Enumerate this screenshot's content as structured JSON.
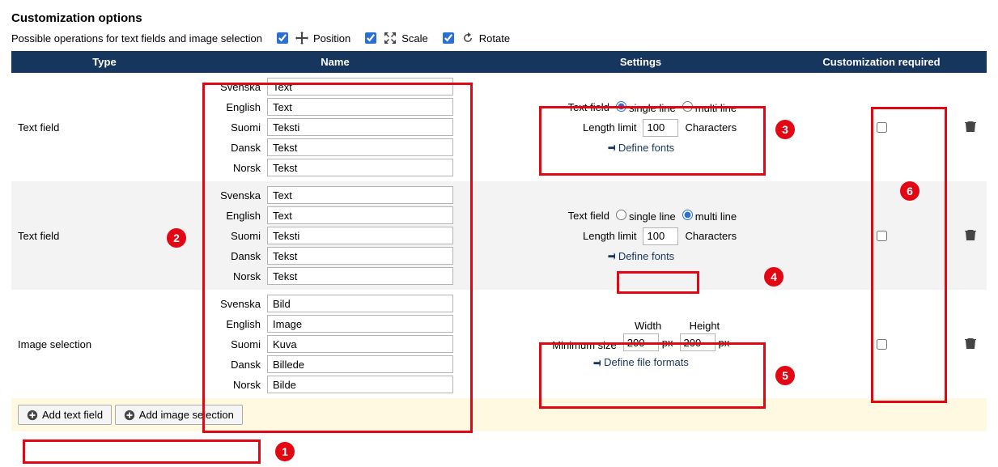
{
  "title": "Customization options",
  "ops_label": "Possible operations for text fields and image selection",
  "ops": {
    "position": "Position",
    "scale": "Scale",
    "rotate": "Rotate"
  },
  "headers": {
    "type": "Type",
    "name": "Name",
    "settings": "Settings",
    "required": "Customization required"
  },
  "langs": {
    "sv": "Svenska",
    "en": "English",
    "fi": "Suomi",
    "da": "Dansk",
    "no": "Norsk"
  },
  "settings_labels": {
    "text_field": "Text field",
    "single_line": "single line",
    "multi_line": "multi line",
    "length_limit": "Length limit",
    "characters": "Characters",
    "define_fonts": "Define fonts",
    "min_size": "Minimum size",
    "width": "Width",
    "height": "Height",
    "px": "px",
    "define_formats": "Define file formats"
  },
  "rows": [
    {
      "type": "Text field",
      "names": {
        "sv": "Text",
        "en": "Text",
        "fi": "Teksti",
        "da": "Tekst",
        "no": "Tekst"
      },
      "mode": "single",
      "length": "100"
    },
    {
      "type": "Text field",
      "names": {
        "sv": "Text",
        "en": "Text",
        "fi": "Teksti",
        "da": "Tekst",
        "no": "Tekst"
      },
      "mode": "multi",
      "length": "100"
    },
    {
      "type": "Image selection",
      "names": {
        "sv": "Bild",
        "en": "Image",
        "fi": "Kuva",
        "da": "Billede",
        "no": "Bilde"
      },
      "width": "200",
      "height": "200"
    }
  ],
  "footer": {
    "add_text": "Add text field",
    "add_image": "Add image selection"
  },
  "badges": [
    "1",
    "2",
    "3",
    "4",
    "5",
    "6"
  ]
}
